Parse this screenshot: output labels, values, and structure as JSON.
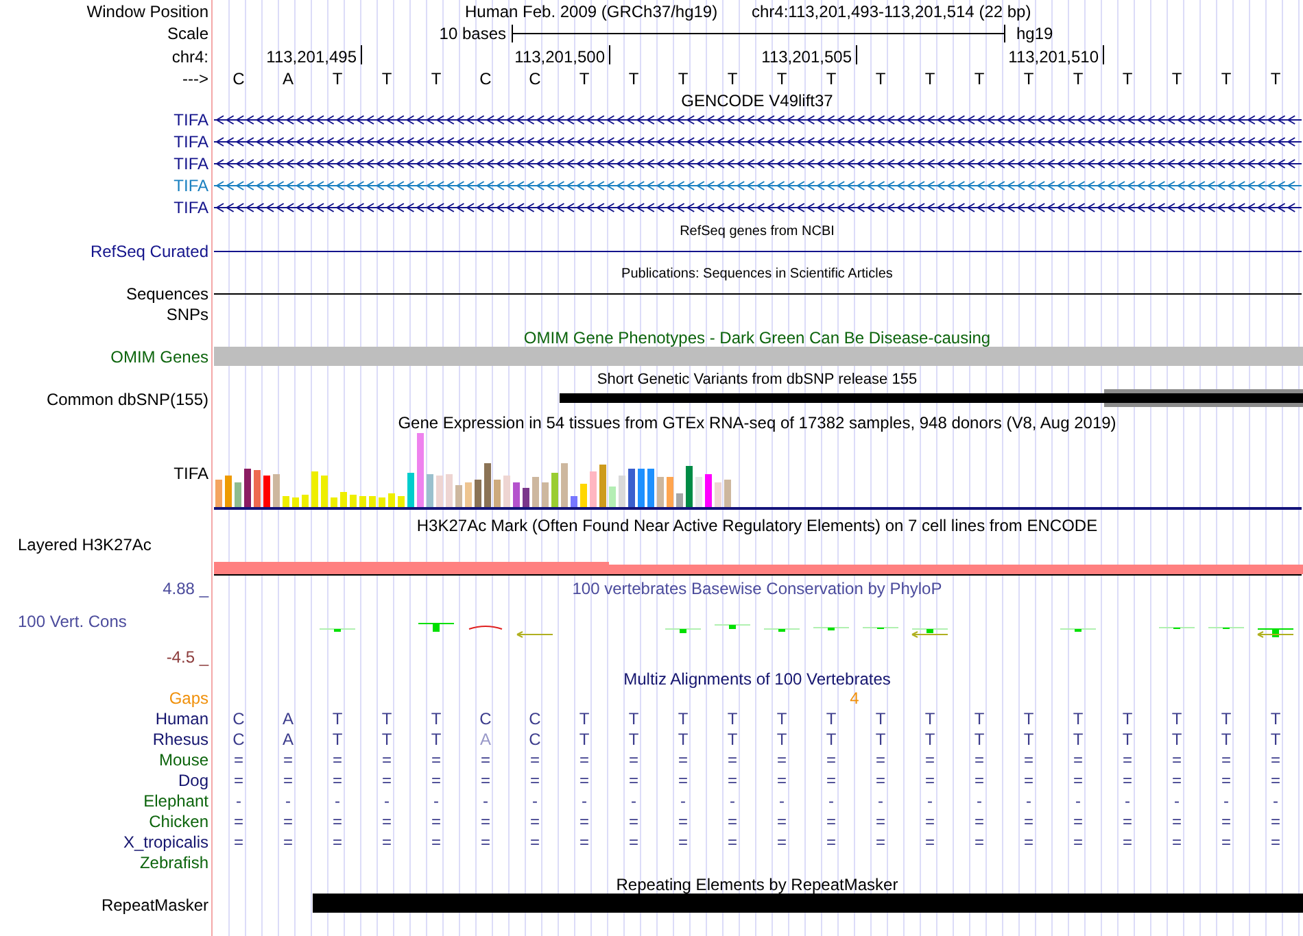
{
  "header": {
    "window_position_label": "Window Position",
    "assembly": "Human Feb. 2009 (GRCh37/hg19)",
    "position": "chr4:113,201,493-113,201,514 (22 bp)",
    "scale_label": "Scale",
    "scale_length": "10 bases",
    "scale_assembly": "hg19",
    "chromosome_label": "chr4:",
    "ruler_ticks": [
      "113,201,495",
      "113,201,500",
      "113,201,505",
      "113,201,510"
    ],
    "strand_label": "--->",
    "bases": [
      "C",
      "A",
      "T",
      "T",
      "T",
      "C",
      "C",
      "T",
      "T",
      "T",
      "T",
      "T",
      "T",
      "T",
      "T",
      "T",
      "T",
      "T",
      "T",
      "T",
      "T",
      "T"
    ]
  },
  "tracks": [
    {
      "kind": "genes",
      "title": "GENCODE V49lift37",
      "items": [
        {
          "label": "TIFA",
          "color": "#14148c"
        },
        {
          "label": "TIFA",
          "color": "#14148c"
        },
        {
          "label": "TIFA",
          "color": "#14148c"
        },
        {
          "label": "TIFA",
          "color": "#1a80c0"
        },
        {
          "label": "TIFA",
          "color": "#14148c"
        }
      ]
    },
    {
      "kind": "line",
      "title": "RefSeq genes from NCBI",
      "labels": [
        "RefSeq Curated"
      ],
      "color": "#14148c"
    },
    {
      "kind": "line",
      "title": "Publications: Sequences in Scientific Articles",
      "labels": [
        "Sequences",
        "SNPs"
      ]
    },
    {
      "kind": "block",
      "title": "OMIM Gene Phenotypes - Dark Green Can Be Disease-causing",
      "labels": [
        "OMIM Genes"
      ],
      "color": "#0c640c"
    },
    {
      "kind": "snp",
      "title": "Short Genetic Variants from dbSNP release 155",
      "labels": [
        "Common dbSNP(155)"
      ]
    },
    {
      "kind": "expression",
      "title": "Gene Expression in 54 tissues from GTEx RNA-seq of 17382 samples, 948 donors (V8, Aug 2019)",
      "labels": [
        "TIFA"
      ]
    },
    {
      "kind": "layered",
      "title": "H3K27Ac Mark (Often Found Near Active Regulatory Elements) on 7 cell lines from ENCODE",
      "labels": [
        "Layered H3K27Ac"
      ]
    },
    {
      "kind": "wiggle",
      "title": "100 vertebrates Basewise Conservation by PhyloP",
      "labels": [
        "100 Vert. Cons"
      ],
      "color": "#4b4b9c",
      "max": "4.88 _",
      "min": "-4.5 _"
    },
    {
      "kind": "multiz",
      "title": "Multiz Alignments of 100 Vertebrates",
      "gaps_label": "Gaps",
      "gap_count": "4",
      "species": [
        {
          "name": "Human",
          "color": "#14146e",
          "bases": [
            "C",
            "A",
            "T",
            "T",
            "T",
            "C",
            "C",
            "T",
            "T",
            "T",
            "T",
            "T",
            "T",
            "T",
            "T",
            "T",
            "T",
            "T",
            "T",
            "T",
            "T",
            "T"
          ],
          "mismatch": [
            false,
            false,
            false,
            false,
            false,
            false,
            false,
            false,
            false,
            false,
            false,
            false,
            false,
            false,
            false,
            false,
            false,
            false,
            false,
            false,
            false,
            false
          ]
        },
        {
          "name": "Rhesus",
          "color": "#14146e",
          "bases": [
            "C",
            "A",
            "T",
            "T",
            "T",
            "A",
            "C",
            "T",
            "T",
            "T",
            "T",
            "T",
            "T",
            "T",
            "T",
            "T",
            "T",
            "T",
            "T",
            "T",
            "T",
            "T"
          ],
          "mismatch": [
            false,
            false,
            false,
            false,
            false,
            true,
            false,
            false,
            false,
            false,
            false,
            false,
            false,
            false,
            false,
            false,
            false,
            false,
            false,
            false,
            false,
            false
          ]
        },
        {
          "name": "Mouse",
          "color": "#0c640c",
          "bases": [
            "=",
            "=",
            "=",
            "=",
            "=",
            "=",
            "=",
            "=",
            "=",
            "=",
            "=",
            "=",
            "=",
            "=",
            "=",
            "=",
            "=",
            "=",
            "=",
            "=",
            "=",
            "="
          ]
        },
        {
          "name": "Dog",
          "color": "#14146e",
          "bases": [
            "=",
            "=",
            "=",
            "=",
            "=",
            "=",
            "=",
            "=",
            "=",
            "=",
            "=",
            "=",
            "=",
            "=",
            "=",
            "=",
            "=",
            "=",
            "=",
            "=",
            "=",
            "="
          ]
        },
        {
          "name": "Elephant",
          "color": "#0c640c",
          "bases": [
            "-",
            "-",
            "-",
            "-",
            "-",
            "-",
            "-",
            "-",
            "-",
            "-",
            "-",
            "-",
            "-",
            "-",
            "-",
            "-",
            "-",
            "-",
            "-",
            "-",
            "-",
            "-"
          ]
        },
        {
          "name": "Chicken",
          "color": "#0c640c",
          "bases": [
            "=",
            "=",
            "=",
            "=",
            "=",
            "=",
            "=",
            "=",
            "=",
            "=",
            "=",
            "=",
            "=",
            "=",
            "=",
            "=",
            "=",
            "=",
            "=",
            "=",
            "=",
            "="
          ]
        },
        {
          "name": "X_tropicalis",
          "color": "#14146e",
          "bases": [
            "=",
            "=",
            "=",
            "=",
            "=",
            "=",
            "=",
            "=",
            "=",
            "=",
            "=",
            "=",
            "=",
            "=",
            "=",
            "=",
            "=",
            "=",
            "=",
            "=",
            "=",
            "="
          ]
        },
        {
          "name": "Zebrafish",
          "color": "#0c640c"
        }
      ]
    },
    {
      "kind": "repeat",
      "title": "Repeating Elements by RepeatMasker",
      "labels": [
        "RepeatMasker"
      ]
    }
  ]
}
